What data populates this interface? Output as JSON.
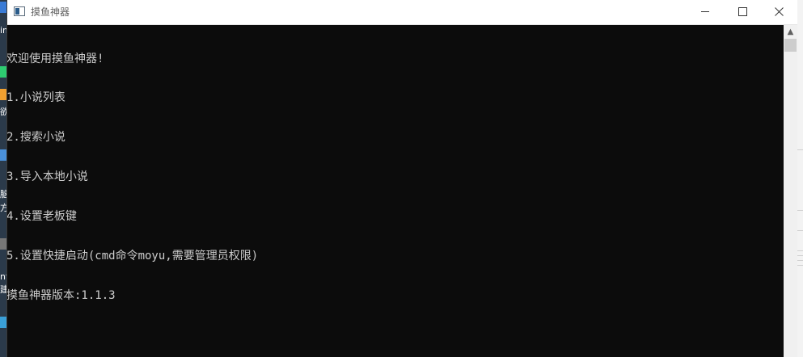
{
  "window": {
    "title": "摸鱼神器"
  },
  "console": {
    "lines": [
      "欢迎使用摸鱼神器!",
      "1.小说列表",
      "2.搜索小说",
      "3.导入本地小说",
      "4.设置老板键",
      "5.设置快捷启动(cmd命令moyu,需要管理员权限)",
      "摸鱼神器版本:1.1.3"
    ],
    "text_color": "#cccccc",
    "background": "#0c0c0c"
  },
  "desktop": {
    "left_labels": [
      "im",
      "欲",
      "脑",
      "方",
      "nf",
      "建"
    ]
  },
  "icons": {
    "window_icon": "console-window-icon",
    "minimize": "minimize-icon",
    "maximize": "maximize-icon",
    "close": "close-icon",
    "scroll_up": "scroll-up-arrow-icon"
  }
}
